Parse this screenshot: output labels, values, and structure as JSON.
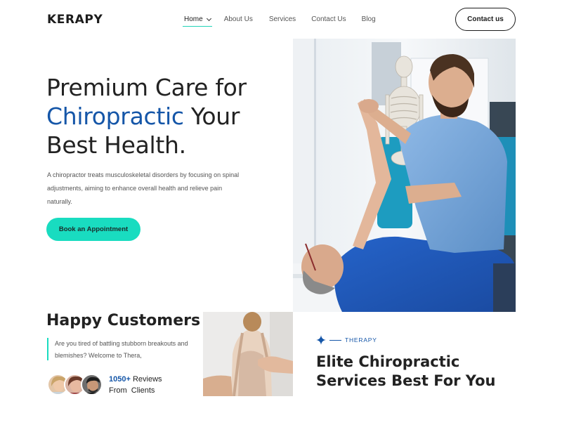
{
  "header": {
    "logo": "KERAPY",
    "nav": [
      {
        "label": "Home"
      },
      {
        "label": "About Us"
      },
      {
        "label": "Services"
      },
      {
        "label": "Contact Us"
      },
      {
        "label": "Blog"
      }
    ],
    "contact_button": "Contact us"
  },
  "hero": {
    "title_line1": "Premium Care for",
    "title_accent": "Chiropractic",
    "title_rest": " Your",
    "title_line3": "Best Health.",
    "description": "A chiropractor treats musculoskeletal disorders by focusing on spinal adjustments, aiming to enhance overall health and relieve pain naturally.",
    "cta": "Book an Appointment"
  },
  "customers": {
    "title": "Happy Customers",
    "text": "Are you tired of battling stubborn breakouts and blemishes? Welcome to Thera,",
    "reviews_count": "1050+",
    "reviews_word": "Reviews",
    "reviews_suffix": "From  Clients"
  },
  "therapy": {
    "label": "THERAPY",
    "title_light1": "Elite ",
    "title_bold1": "Chiropractic",
    "title_bold2": "Services",
    "title_light2": " Best For You"
  },
  "colors": {
    "accent": "#1556a8",
    "teal": "#19dcc0"
  },
  "icons": [
    "chevron-down-icon",
    "sparkle-star-icon"
  ]
}
